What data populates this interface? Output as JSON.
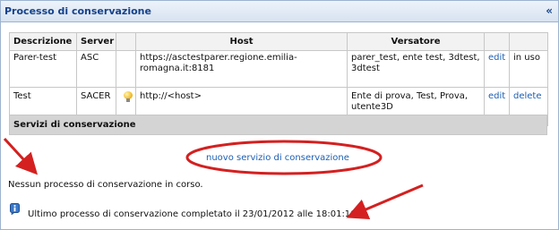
{
  "panel": {
    "title": "Processo di conservazione",
    "collapse_glyph": "«"
  },
  "table": {
    "headers": [
      "Descrizione",
      "Server",
      "",
      "Host",
      "Versatore",
      "",
      ""
    ],
    "rows": [
      {
        "descrizione": "Parer-test",
        "server": "ASC",
        "icon": "",
        "host": "https://asctestparer.regione.emilia-romagna.it:8181",
        "versatore": "parer_test, ente test, 3dtest, 3dtest",
        "action": "edit",
        "status": "in uso"
      },
      {
        "descrizione": "Test",
        "server": "SACER",
        "icon": "lightbulb-icon",
        "host": "http://<host>",
        "versatore": "Ente di prova, Test, Prova, utente3D",
        "action": "edit",
        "status": "delete"
      }
    ]
  },
  "section": {
    "title": "Servizi di conservazione",
    "new_link": "nuovo servizio di conservazione"
  },
  "messages": {
    "no_process": "Nessun processo di conservazione in corso.",
    "last_process": "Ultimo processo di conservazione completato il 23/01/2012 alle 18:01:10"
  },
  "annotation_color": "#d42020"
}
